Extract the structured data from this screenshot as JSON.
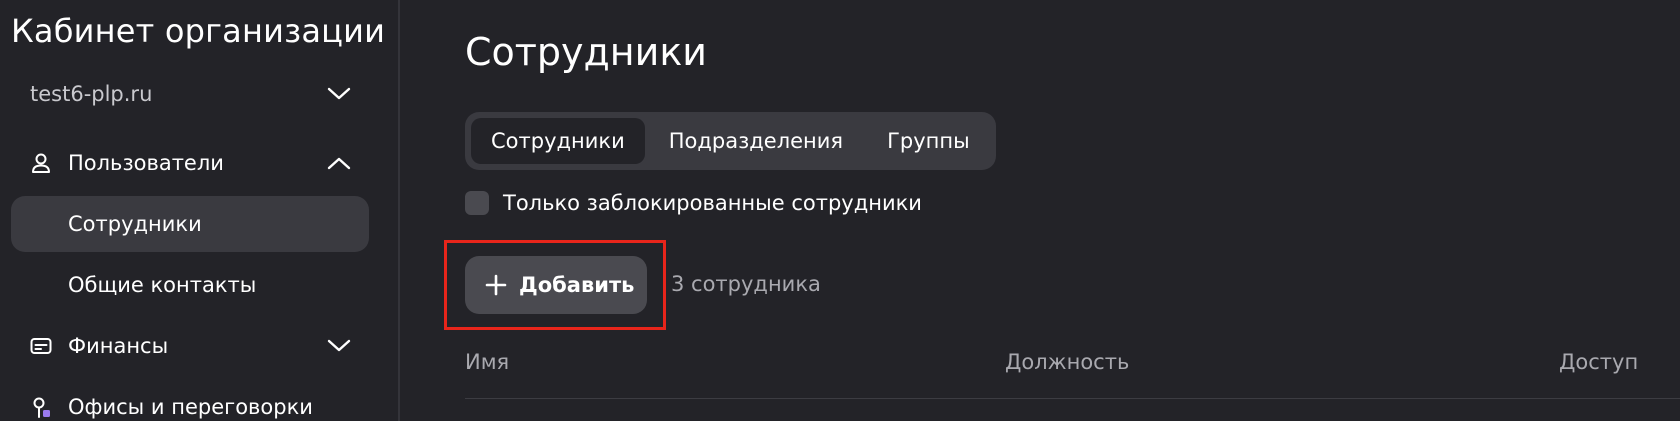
{
  "sidebar": {
    "title": "Кабинет организации",
    "org": {
      "name": "test6-plp.ru"
    },
    "sections": [
      {
        "label": "Пользователи",
        "icon": "user-icon",
        "expanded": true
      },
      {
        "label": "Финансы",
        "icon": "card-icon",
        "expanded": false
      },
      {
        "label": "Офисы и переговорки",
        "icon": "pin-icon",
        "expanded": false
      }
    ],
    "items": [
      {
        "label": "Сотрудники",
        "active": true
      },
      {
        "label": "Общие контакты",
        "active": false
      }
    ]
  },
  "main": {
    "title": "Сотрудники",
    "tabs": [
      {
        "label": "Сотрудники",
        "active": true
      },
      {
        "label": "Подразделения",
        "active": false
      },
      {
        "label": "Группы",
        "active": false
      }
    ],
    "filter": {
      "label": "Только заблокированные сотрудники",
      "checked": false
    },
    "add_button": {
      "label": "Добавить",
      "icon": "plus-icon"
    },
    "count": "3 сотрудника",
    "columns": [
      "Имя",
      "Должность",
      "Доступ"
    ]
  },
  "colors": {
    "background": "#232328",
    "surface": "#3a3a40",
    "button": "#4a4a50",
    "highlight": "#e8251b",
    "muted_text": "#a9a9af"
  }
}
